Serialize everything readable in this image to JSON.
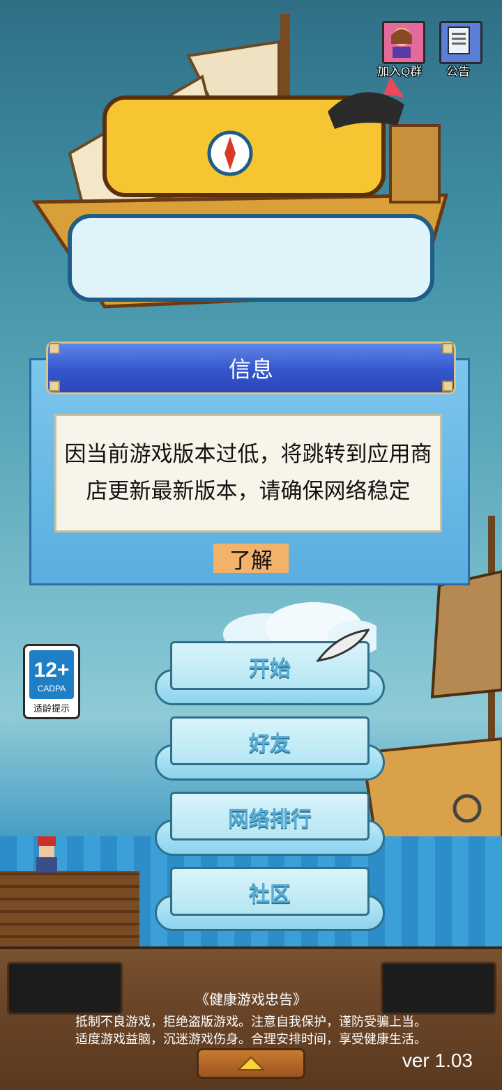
{
  "top_buttons": [
    {
      "label": "加入Q群",
      "icon": "avatar-icon"
    },
    {
      "label": "公告",
      "icon": "notice-document-icon"
    }
  ],
  "dialog": {
    "title": "信息",
    "message": "因当前游戏版本过低，将跳转到应用商店更新最新版本，请确保网络稳定",
    "ok_label": "了解"
  },
  "age_rating": {
    "number": "12+",
    "org": "CADPA",
    "caption": "适龄提示"
  },
  "menu": [
    {
      "label": "开始"
    },
    {
      "label": "好友"
    },
    {
      "label": "网络排行"
    },
    {
      "label": "社区"
    }
  ],
  "footer": {
    "notice_title": "《健康游戏忠告》",
    "notice_lines": [
      "抵制不良游戏，拒绝盗版游戏。注意自我保护，谨防受骗上当。",
      "适度游戏益脑，沉迷游戏伤身。合理安排时间，享受健康生活。"
    ],
    "version": "ver 1.03",
    "up_icon": "triangle-up-icon"
  }
}
